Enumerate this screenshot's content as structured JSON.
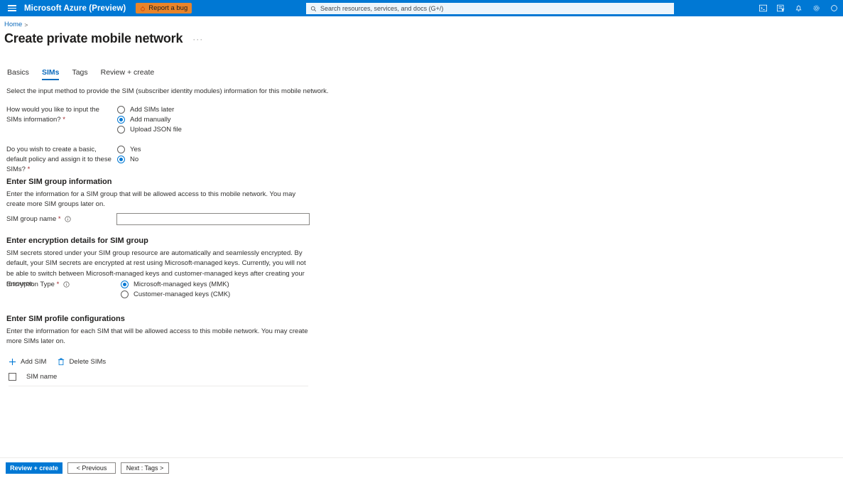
{
  "topbar": {
    "menu_icon": "hamburger-icon",
    "brand": "Microsoft Azure (Preview)",
    "report_bug_label": "Report a bug",
    "report_bug_icon": "bug-icon",
    "report_bug_color": "#e8842a",
    "brand_bar_color": "#0078d4",
    "search": {
      "placeholder": "Search resources, services, and docs (G+/)",
      "icon": "search-icon"
    },
    "icons": [
      {
        "name": "cloud-shell-icon"
      },
      {
        "name": "directory-filter-icon"
      },
      {
        "name": "notifications-bell-icon"
      },
      {
        "name": "settings-gear-icon"
      },
      {
        "name": "help-question-icon"
      }
    ]
  },
  "breadcrumb": {
    "items": [
      "Home"
    ],
    "separator": ">"
  },
  "page": {
    "title": "Create private mobile network",
    "ellipsis": "···"
  },
  "tabs": [
    {
      "label": "Basics",
      "active": false
    },
    {
      "label": "SIMs",
      "active": true
    },
    {
      "label": "Tags",
      "active": false
    },
    {
      "label": "Review + create",
      "active": false
    }
  ],
  "intro": "Select the input method to provide the SIM (subscriber identity modules) information for this mobile network.",
  "fields": {
    "input_method": {
      "label": "How would you like to input the SIMs information?",
      "required": "*",
      "options": [
        {
          "label": "Add SIMs later",
          "selected": false
        },
        {
          "label": "Add manually",
          "selected": true
        },
        {
          "label": "Upload JSON file",
          "selected": false
        }
      ]
    },
    "default_policy": {
      "label": "Do you wish to create a basic, default policy and assign it to these SIMs?",
      "required": "*",
      "options": [
        {
          "label": "Yes",
          "selected": false
        },
        {
          "label": "No",
          "selected": true
        }
      ]
    }
  },
  "sim_group_section": {
    "heading": "Enter SIM group information",
    "description": "Enter the information for a SIM group that will be allowed access to this mobile network. You may create more SIM groups later on.",
    "name_label": "SIM group name",
    "name_required": "*",
    "name_info_icon": "info-icon",
    "name_value": "",
    "name_placeholder": ""
  },
  "encryption_section": {
    "heading": "Enter encryption details for SIM group",
    "description": "SIM secrets stored under your SIM group resource are automatically and seamlessly encrypted. By default, your SIM secrets are encrypted at rest using Microsoft-managed keys. Currently, you will not be able to switch between Microsoft-managed keys and customer-managed keys after creating your resource.",
    "type_label": "Encryption Type",
    "type_required": "*",
    "type_info_icon": "info-icon",
    "options": [
      {
        "label": "Microsoft-managed keys (MMK)",
        "selected": true
      },
      {
        "label": "Customer-managed keys (CMK)",
        "selected": false
      }
    ]
  },
  "sim_profile_section": {
    "heading": "Enter SIM profile configurations",
    "description": "Enter the information for each SIM that will be allowed access to this mobile network. You may create more SIMs later on.",
    "commands": [
      {
        "label": "Add SIM",
        "icon": "plus-icon"
      },
      {
        "label": "Delete SIMs",
        "icon": "trash-icon"
      }
    ],
    "table": {
      "select_all_icon": "checkbox-icon",
      "columns": [
        "SIM name"
      ],
      "rows": []
    }
  },
  "footer": {
    "buttons": [
      {
        "label": "Review + create",
        "style": "primary"
      },
      {
        "label": "< Previous",
        "style": "default"
      },
      {
        "label": "Next : Tags >",
        "style": "default"
      }
    ]
  },
  "colors": {
    "accent": "#0078d4",
    "link": "#0f6cbd",
    "required": "#a4262c",
    "warning": "#e8842a"
  }
}
